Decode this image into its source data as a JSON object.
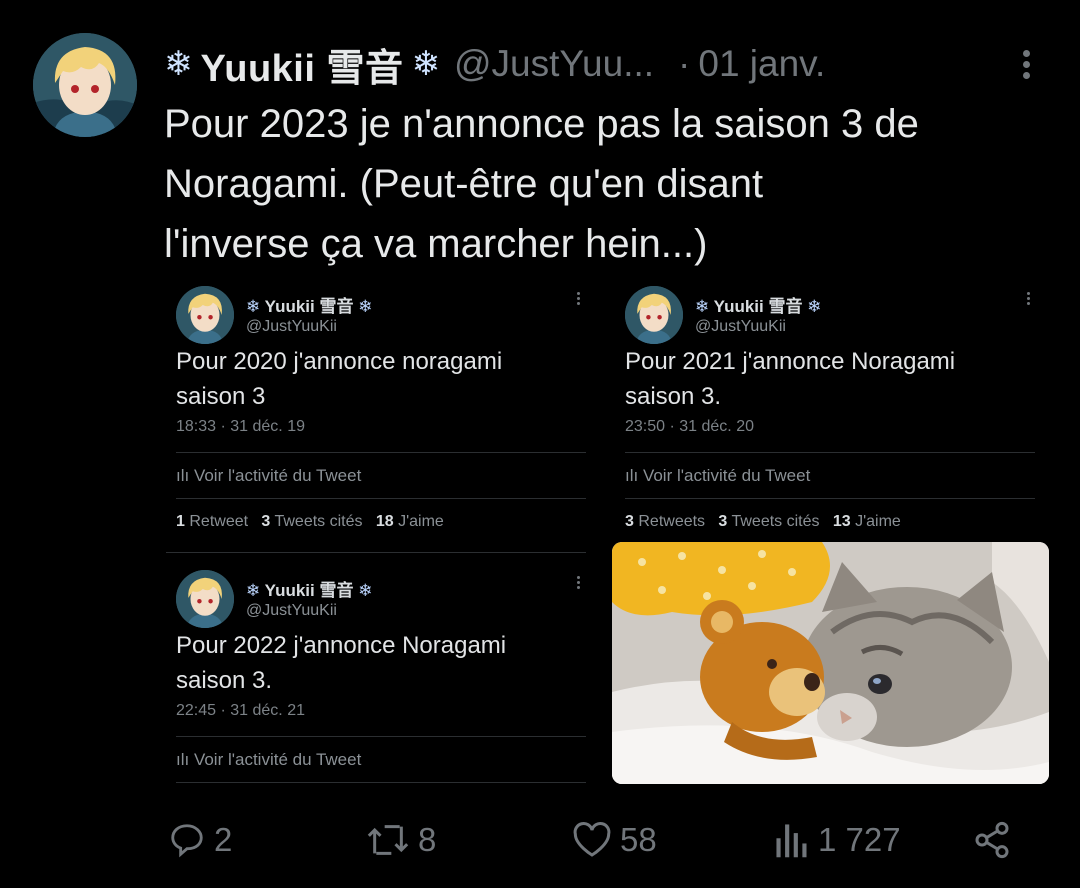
{
  "tweet": {
    "display_name": "Yuukii 雪音",
    "name_decoration": "❄",
    "handle": "@JustYuu...",
    "separator": "·",
    "date": "01 janv.",
    "text_lines": [
      "Pour 2023 je n'annonce pas la saison 3 de",
      "Noragami. (Peut-être qu'en disant",
      "l'inverse ça va marcher hein...)"
    ]
  },
  "embedded": {
    "name": "Yuukii 雪音",
    "flake": "❄",
    "handle": "@JustYuuKii",
    "activity_label": "ılı Voir l'activité du Tweet",
    "cards": [
      {
        "text_lines": [
          "Pour 2020 j'annonce noragami",
          "saison 3"
        ],
        "time": "18:33 · 31 déc. 19",
        "stats": {
          "retweets": "1",
          "retweets_label": "Retweet",
          "quotes": "3",
          "quotes_label": "Tweets cités",
          "likes": "18",
          "likes_label": "J'aime"
        }
      },
      {
        "text_lines": [
          "Pour 2021 j'annonce Noragami",
          "saison 3."
        ],
        "time": "23:50 · 31 déc. 20",
        "stats": {
          "retweets": "3",
          "retweets_label": "Retweets",
          "quotes": "3",
          "quotes_label": "Tweets cités",
          "likes": "13",
          "likes_label": "J'aime"
        }
      },
      {
        "text_lines": [
          "Pour 2022 j'annonce Noragami",
          "saison 3."
        ],
        "time": "22:45 · 31 déc. 21"
      }
    ]
  },
  "actions": {
    "replies": "2",
    "retweets": "8",
    "likes": "58",
    "views": "1 727"
  },
  "icons": [
    "reply-icon",
    "retweet-icon",
    "like-icon",
    "views-icon",
    "share-icon"
  ],
  "colors": {
    "background": "#000000",
    "text": "#e7e9ea",
    "secondary": "#71767b"
  }
}
